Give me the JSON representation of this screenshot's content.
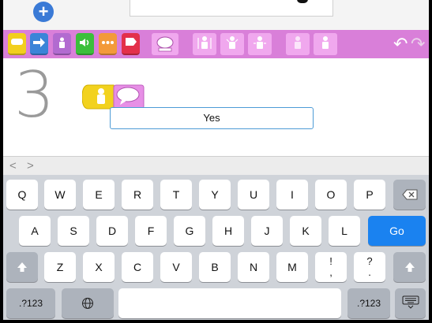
{
  "toolbar": {
    "add_glyph": "+"
  },
  "palette": {
    "categories": [
      {
        "name": "triggering-blocks",
        "color": "#f2cf1e"
      },
      {
        "name": "motion-blocks",
        "color": "#3b84d8"
      },
      {
        "name": "looks-blocks",
        "color": "#b26bd0"
      },
      {
        "name": "sound-blocks",
        "color": "#3bbf3b"
      },
      {
        "name": "control-blocks",
        "color": "#f39a3a"
      },
      {
        "name": "end-blocks",
        "color": "#e3304a"
      }
    ],
    "undo_glyph": "↶",
    "redo_glyph": "↷"
  },
  "canvas": {
    "page_number": "3",
    "speech_text": "Yes"
  },
  "keyboard": {
    "rows": [
      [
        "Q",
        "W",
        "E",
        "R",
        "T",
        "Y",
        "U",
        "I",
        "O",
        "P"
      ],
      [
        "A",
        "S",
        "D",
        "F",
        "G",
        "H",
        "J",
        "K",
        "L"
      ],
      [
        "Z",
        "X",
        "C",
        "V",
        "B",
        "N",
        "M"
      ]
    ],
    "go_label": "Go",
    "numbers_label": ".?123",
    "numbers_label_right": ".?123",
    "punct_1_top": "!",
    "punct_1_bottom": ",",
    "punct_2_top": "?",
    "punct_2_bottom": ".",
    "nav_prev": "<",
    "nav_next": ">"
  }
}
